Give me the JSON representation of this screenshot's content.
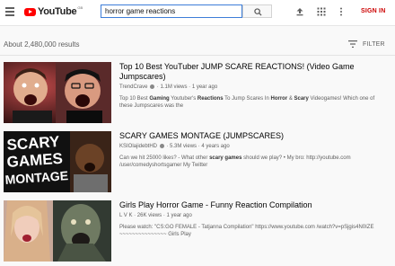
{
  "header": {
    "logo_text": "YouTube",
    "logo_region": "GB",
    "search_value": "horror game reactions",
    "signin_label": "SIGN IN"
  },
  "results": {
    "count_text": "About 2,480,000 results",
    "filter_label": "FILTER"
  },
  "videos": [
    {
      "title": "Top 10 Best YouTuber JUMP SCARE REACTIONS! (Video Game Jumpscares)",
      "channel": "TrendCrave",
      "views": "1.1M views",
      "age": "1 year ago",
      "desc_parts": [
        "Top 10 Best ",
        "Gaming",
        " Youtuber's ",
        "Reactions",
        " To Jump Scares In ",
        "Horror",
        " & ",
        "Scary",
        " Videogames! Which one of these Jumpscares was the"
      ]
    },
    {
      "title": "SCARY GAMES MONTAGE (JUMPSCARES)",
      "channel": "KSIOlajidebtHD",
      "views": "5.3M views",
      "age": "4 years ago",
      "desc_parts": [
        "Can we hit 25000 likes? - What other ",
        "scary games",
        " should we play? • My bro: http://youtube.com /user/comedyshortsgamer My Twitter",
        "",
        "",
        "",
        "",
        "",
        ""
      ],
      "thumb_text": "SCARY GAMES MONTAGE"
    },
    {
      "title": "Girls Play Horror Game - Funny Reaction Compilation",
      "channel": "L V K",
      "views": "26K views",
      "age": "1 year ago",
      "desc_parts": [
        "Please watch: \"CS:GO FEMALE - Tatjanna Compilation\" https://www.youtube.com /watch?v=pSjgis4N0IZE ~~~~~~~~~~~~~~~ Girls Play",
        "",
        "",
        "",
        "",
        "",
        "",
        "",
        ""
      ]
    }
  ]
}
